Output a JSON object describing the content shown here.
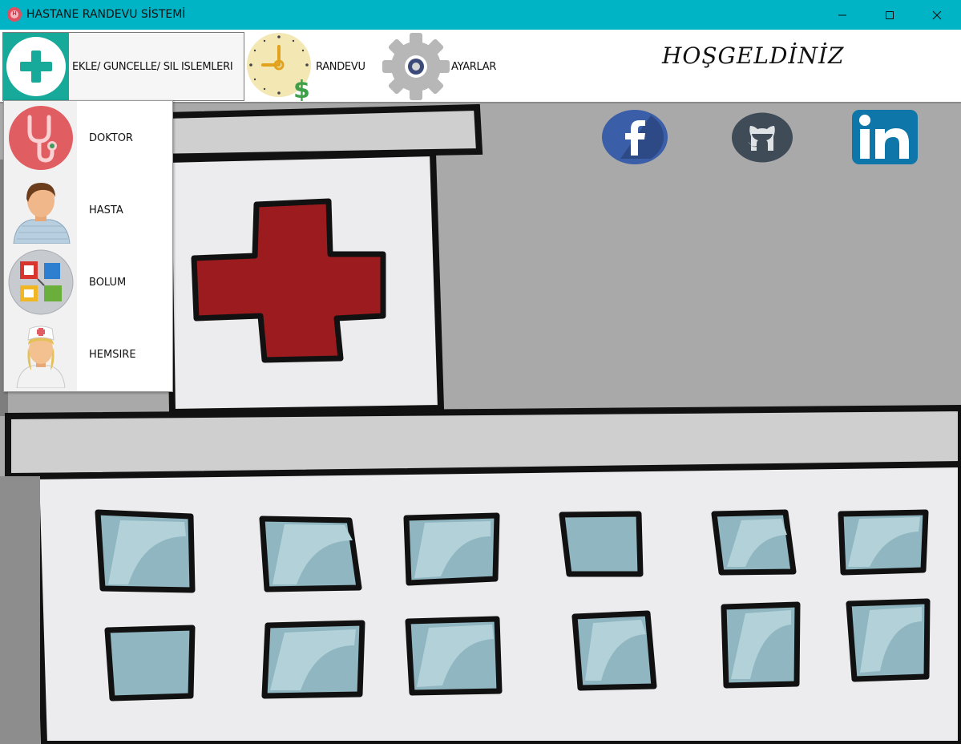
{
  "window": {
    "title": "HASTANE RANDEVU SİSTEMİ",
    "title_bar_color": "#00b4c5"
  },
  "toolbar": {
    "ekle_label": "EKLE/ GUNCELLE/ SIL ISLEMLERI",
    "ekle_icon": "plus-icon",
    "randevu_label": "RANDEVU",
    "randevu_icon": "clock-dollar-icon",
    "ayarlar_label": "AYARLAR",
    "ayarlar_icon": "gear-icon",
    "welcome_text": "HOŞGELDİNİZ"
  },
  "menu": {
    "items": [
      {
        "label": "DOKTOR",
        "icon": "stethoscope-icon"
      },
      {
        "label": "HASTA",
        "icon": "patient-icon"
      },
      {
        "label": "BOLUM",
        "icon": "department-icon"
      },
      {
        "label": "HEMSIRE",
        "icon": "nurse-icon"
      }
    ]
  },
  "social": [
    {
      "icon": "facebook-icon",
      "color": "#3b5998"
    },
    {
      "icon": "github-icon",
      "color": "#3f4b57"
    },
    {
      "icon": "linkedin-icon",
      "color": "#0e76a8"
    }
  ],
  "colors": {
    "accent_teal": "#17a99a",
    "cross_red": "#9b1b1e",
    "window_blue": "#8fb6c1"
  }
}
